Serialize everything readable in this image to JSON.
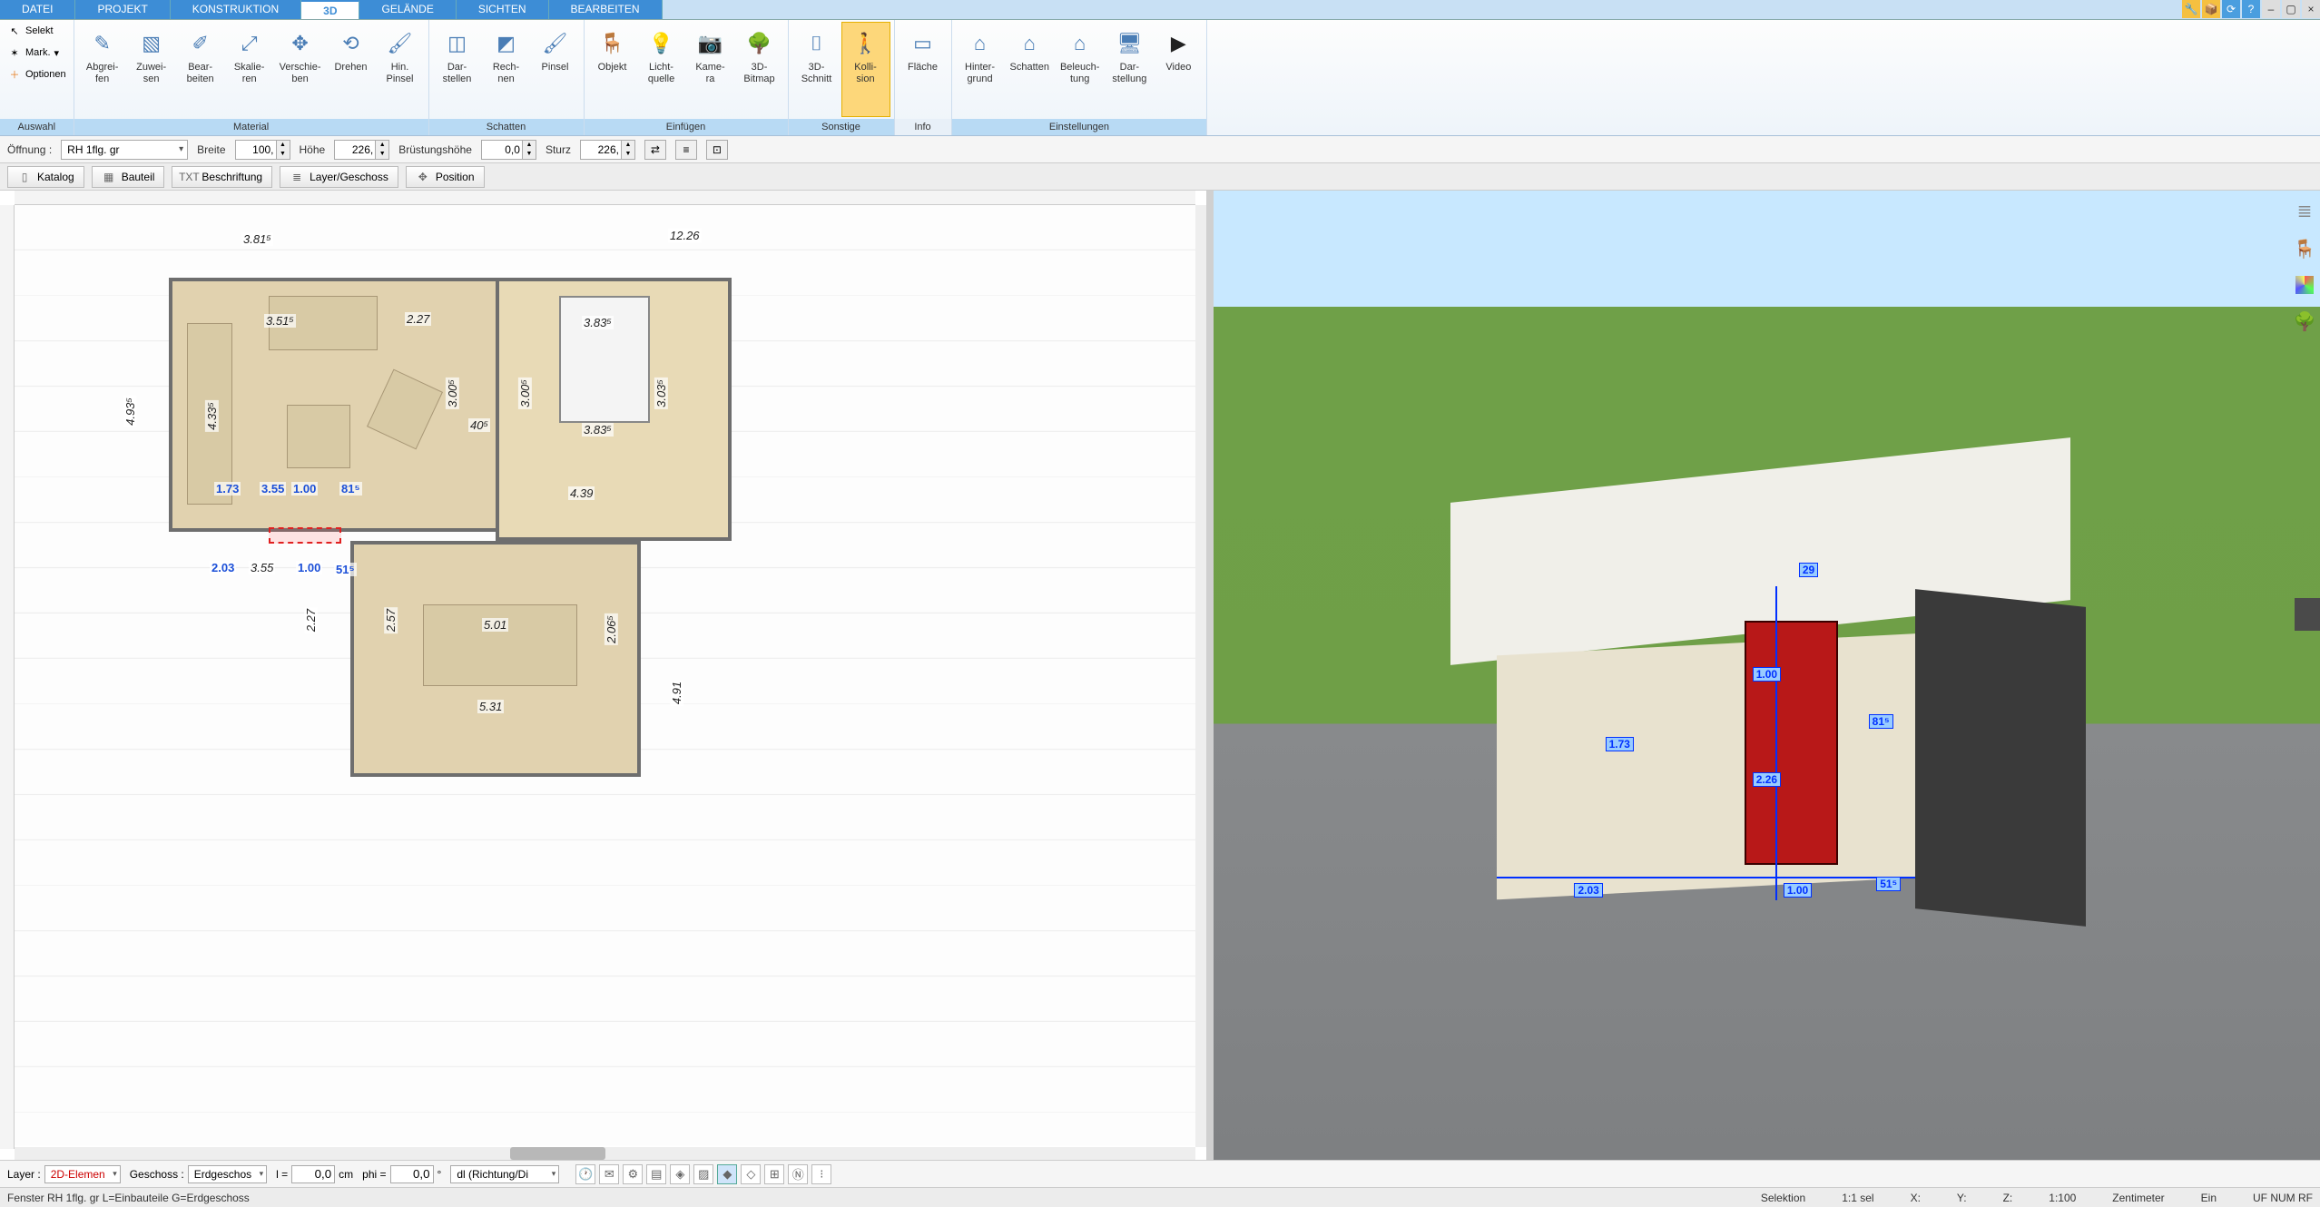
{
  "tabs": {
    "file": "DATEI",
    "project": "PROJEKT",
    "construction": "KONSTRUKTION",
    "threeD": "3D",
    "terrain": "GELÄNDE",
    "views": "SICHTEN",
    "edit": "BEARBEITEN"
  },
  "selection": {
    "selekt": "Selekt",
    "mark": "Mark.",
    "options": "Optionen",
    "group": "Auswahl"
  },
  "ribbon": {
    "material": {
      "group": "Material",
      "abgreifen": "Abgrei-\nfen",
      "zuweisen": "Zuwei-\nsen",
      "bearbeiten": "Bear-\nbeiten",
      "skalieren": "Skalie-\nren",
      "verschieben": "Verschie-\nben",
      "drehen": "Drehen",
      "hinpinsel": "Hin.\nPinsel"
    },
    "schatten": {
      "group": "Schatten",
      "darstellen": "Dar-\nstellen",
      "rechnen": "Rech-\nnen",
      "pinsel": "Pinsel"
    },
    "einfuegen": {
      "group": "Einfügen",
      "objekt": "Objekt",
      "lichtquelle": "Licht-\nquelle",
      "kamera": "Kame-\nra",
      "bitmap3d": "3D-\nBitmap"
    },
    "sonstige": {
      "group": "Sonstige",
      "schnitt3d": "3D-\nSchnitt",
      "kollision": "Kolli-\nsion"
    },
    "info": {
      "group": "Info",
      "flaeche": "Fläche"
    },
    "einstellungen": {
      "group": "Einstellungen",
      "hintergrund": "Hinter-\ngrund",
      "schatten": "Schatten",
      "beleuchtung": "Beleuch-\ntung",
      "darstellung": "Dar-\nstellung",
      "video": "Video"
    }
  },
  "propbar": {
    "oeffnung_label": "Öffnung :",
    "oeffnung_value": "RH 1flg. gr",
    "breite_label": "Breite",
    "breite_value": "100,",
    "hoehe_label": "Höhe",
    "hoehe_value": "226,",
    "bruestung_label": "Brüstungshöhe",
    "bruestung_value": "0,0",
    "sturz_label": "Sturz",
    "sturz_value": "226,"
  },
  "toolbar2": {
    "katalog": "Katalog",
    "bauteil": "Bauteil",
    "beschriftung": "Beschriftung",
    "layer": "Layer/Geschoss",
    "position": "Position"
  },
  "plan": {
    "top_dim_left": "3.81⁵",
    "top_dim_right": "12.26",
    "left_dim": "4.93⁵",
    "living": {
      "d1": "3.51⁵",
      "d2": "2.27",
      "d3": "4.33⁵",
      "d4": "3.00⁵",
      "wall40": "40⁵"
    },
    "bed": {
      "d1": "3.83⁵",
      "d2": "3.00⁵",
      "d3": "3.03⁵",
      "d4": "3.83⁵",
      "d5": "4.39"
    },
    "south": {
      "d1": "1.73",
      "d2": "3.55",
      "d3": "1.00",
      "d4": "81⁵",
      "below1": "2.03",
      "below2": "3.55",
      "below3": "1.00",
      "below4": "51⁵"
    },
    "dining": {
      "d1": "2.27",
      "d2": "2.57",
      "d3": "5.01",
      "d4": "2.06⁵",
      "overall": "5.31",
      "right": "4.91"
    }
  },
  "view3d": {
    "dim_top": "29",
    "dim_h1": "81⁵",
    "dim_door_w": "1.00",
    "dim_door_h": "2.26",
    "dim_left": "2.03",
    "dim_right": "51⁵",
    "dim_far": "1.73",
    "dim_inside": "1.00"
  },
  "statusbar1": {
    "layer_label": "Layer :",
    "layer_value": "2D-Elemen",
    "geschoss_label": "Geschoss :",
    "geschoss_value": "Erdgeschos",
    "l_label": "l =",
    "l_value": "0,0",
    "l_unit": "cm",
    "phi_label": "phi =",
    "phi_value": "0,0",
    "phi_unit": "°",
    "dl_value": "dl (Richtung/Di"
  },
  "statusbar2": {
    "hint": "Fenster RH 1flg. gr L=Einbauteile G=Erdgeschoss",
    "selektion": "Selektion",
    "sel_count": "1:1 sel",
    "x": "X:",
    "y": "Y:",
    "z": "Z:",
    "scale": "1:100",
    "unit": "Zentimeter",
    "ein": "Ein",
    "numrf": "UF NUM RF"
  }
}
